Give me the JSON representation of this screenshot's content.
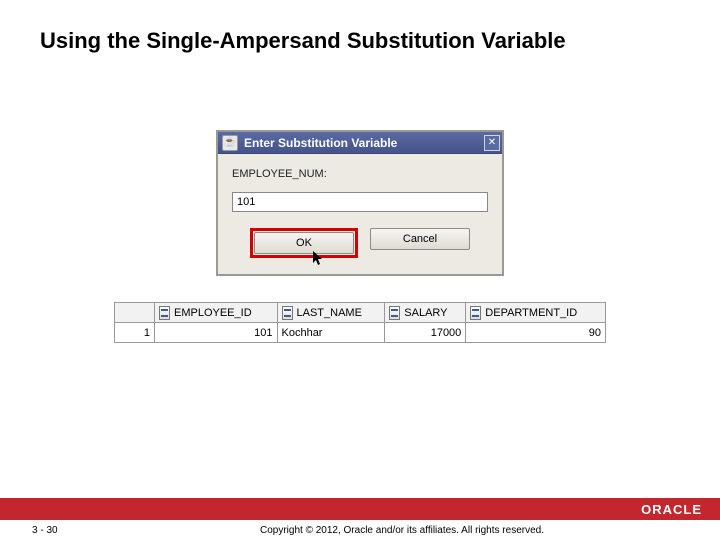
{
  "title": "Using the Single-Ampersand Substitution Variable",
  "dialog": {
    "title": "Enter Substitution Variable",
    "app_icon_glyph": "☕",
    "close_glyph": "✕",
    "field_label": "EMPLOYEE_NUM:",
    "input_value": "101",
    "ok_label": "OK",
    "cancel_label": "Cancel"
  },
  "table": {
    "columns": [
      "EMPLOYEE_ID",
      "LAST_NAME",
      "SALARY",
      "DEPARTMENT_ID"
    ],
    "rows": [
      {
        "n": "1",
        "employee_id": "101",
        "last_name": "Kochhar",
        "salary": "17000",
        "department_id": "90"
      }
    ]
  },
  "footer": {
    "page": "3 - 30",
    "copyright": "Copyright © 2012, Oracle and/or its affiliates. All rights reserved.",
    "logo": "ORACLE"
  }
}
